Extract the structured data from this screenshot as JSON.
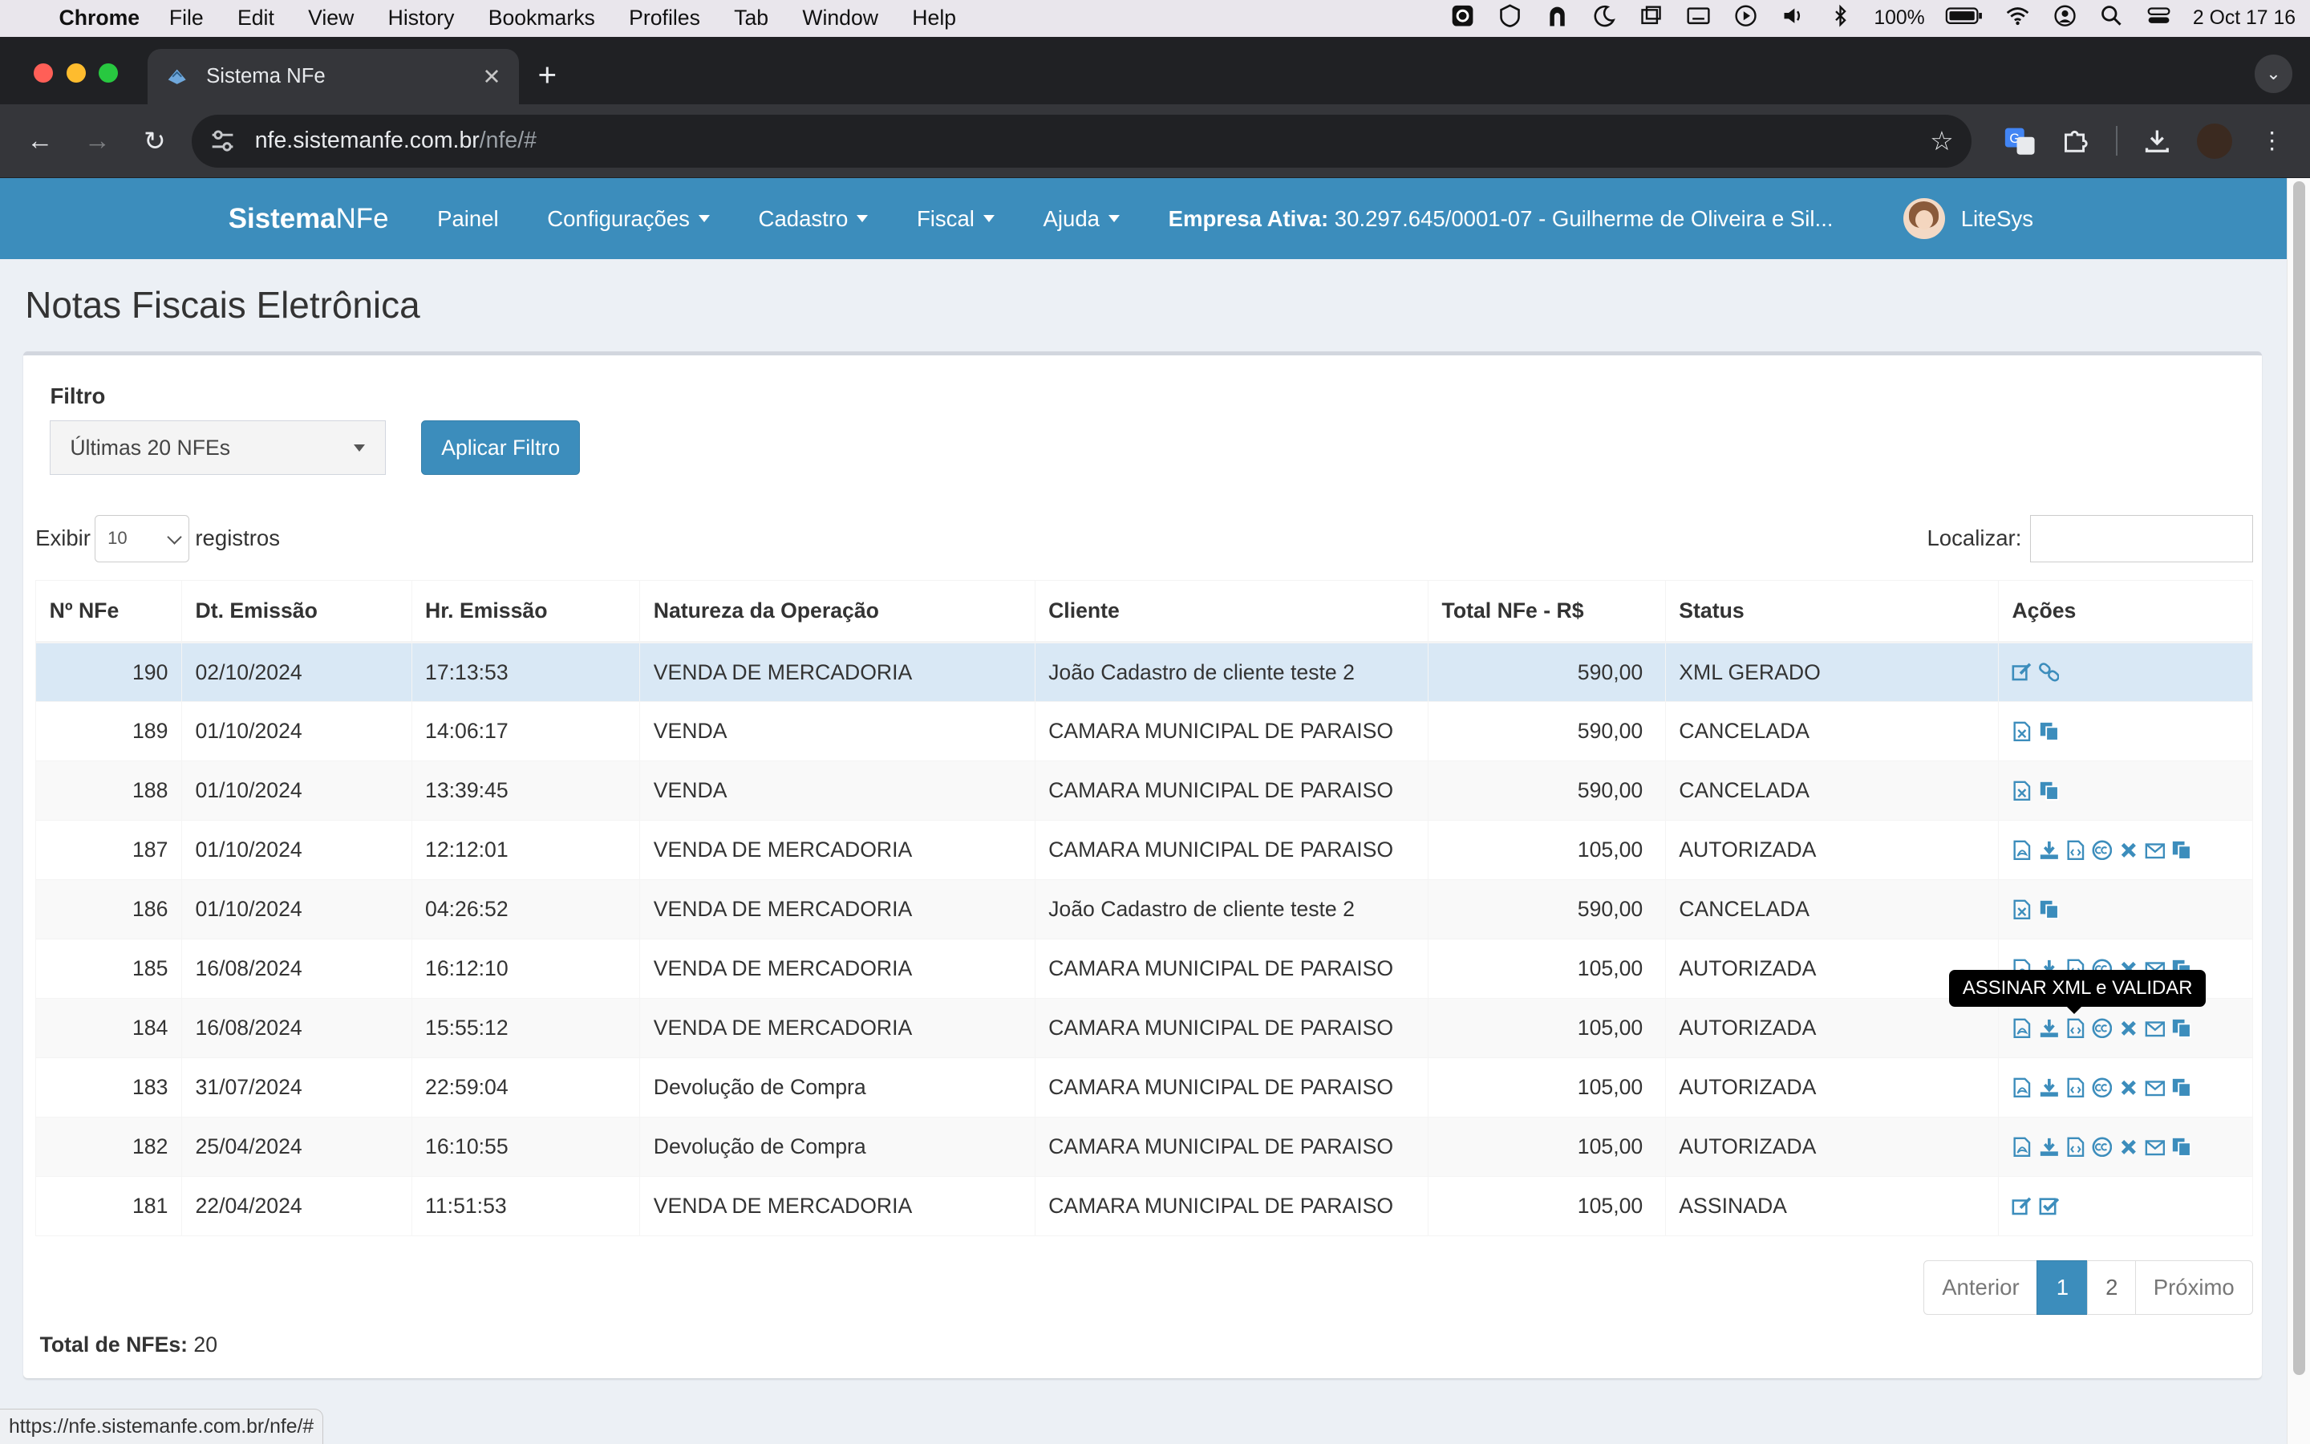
{
  "macos": {
    "app_name": "Chrome",
    "menu": [
      "File",
      "Edit",
      "View",
      "History",
      "Bookmarks",
      "Profiles",
      "Tab",
      "Window",
      "Help"
    ],
    "battery": "100%",
    "clock": "2 Oct  17 16"
  },
  "browser": {
    "tab_title": "Sistema NFe",
    "url_host": "nfe.sistemanfe.com.br",
    "url_path": "/nfe/#",
    "status_url": "https://nfe.sistemanfe.com.br/nfe/#"
  },
  "navbar": {
    "brand_bold": "Sistema",
    "brand_rest": "NFe",
    "items": [
      "Painel",
      "Configurações",
      "Cadastro",
      "Fiscal",
      "Ajuda"
    ],
    "empresa_label": "Empresa Ativa:",
    "empresa_value": " 30.297.645/0001-07 - Guilherme de Oliveira e Sil...",
    "user_name": "LiteSys"
  },
  "page": {
    "title": "Notas Fiscais Eletrônica",
    "filter_label": "Filtro",
    "filter_value": "Últimas 20 NFEs",
    "apply_button": "Aplicar Filtro",
    "show_label": "Exibir",
    "page_length": "10",
    "records_label": "registros",
    "search_label": "Localizar:",
    "tooltip": "ASSINAR XML e VALIDAR",
    "total_label": "Total de NFEs:",
    "total_value": " 20"
  },
  "table": {
    "headers": [
      "Nº NFe",
      "Dt. Emissão",
      "Hr. Emissão",
      "Natureza da Operação",
      "Cliente",
      "Total NFe - R$",
      "Status",
      "Ações"
    ],
    "rows": [
      {
        "n": "190",
        "dt": "02/10/2024",
        "hr": "17:13:53",
        "nat": "VENDA DE MERCADORIA",
        "cli": "João Cadastro de cliente teste 2",
        "tot": "590,00",
        "st": "XML GERADO",
        "acts": [
          "edit-icon",
          "link-icon"
        ]
      },
      {
        "n": "189",
        "dt": "01/10/2024",
        "hr": "14:06:17",
        "nat": "VENDA",
        "cli": "CAMARA MUNICIPAL DE PARAISO",
        "tot": "590,00",
        "st": "CANCELADA",
        "acts": [
          "xml-file-icon",
          "copy-icon"
        ]
      },
      {
        "n": "188",
        "dt": "01/10/2024",
        "hr": "13:39:45",
        "nat": "VENDA",
        "cli": "CAMARA MUNICIPAL DE PARAISO",
        "tot": "590,00",
        "st": "CANCELADA",
        "acts": [
          "xml-file-icon",
          "copy-icon"
        ]
      },
      {
        "n": "187",
        "dt": "01/10/2024",
        "hr": "12:12:01",
        "nat": "VENDA DE MERCADORIA",
        "cli": "CAMARA MUNICIPAL DE PARAISO",
        "tot": "105,00",
        "st": "AUTORIZADA",
        "acts": [
          "pdf-icon",
          "download-icon",
          "code-file-icon",
          "cc-icon",
          "cancel-icon",
          "envelope-icon",
          "copy-icon"
        ]
      },
      {
        "n": "186",
        "dt": "01/10/2024",
        "hr": "04:26:52",
        "nat": "VENDA DE MERCADORIA",
        "cli": "João Cadastro de cliente teste 2",
        "tot": "590,00",
        "st": "CANCELADA",
        "acts": [
          "xml-file-icon",
          "copy-icon"
        ]
      },
      {
        "n": "185",
        "dt": "16/08/2024",
        "hr": "16:12:10",
        "nat": "VENDA DE MERCADORIA",
        "cli": "CAMARA MUNICIPAL DE PARAISO",
        "tot": "105,00",
        "st": "AUTORIZADA",
        "acts": [
          "pdf-icon",
          "download-icon",
          "code-file-icon",
          "cc-icon",
          "cancel-icon",
          "envelope-icon",
          "copy-icon"
        ]
      },
      {
        "n": "184",
        "dt": "16/08/2024",
        "hr": "15:55:12",
        "nat": "VENDA DE MERCADORIA",
        "cli": "CAMARA MUNICIPAL DE PARAISO",
        "tot": "105,00",
        "st": "AUTORIZADA",
        "acts": [
          "pdf-icon",
          "download-icon",
          "code-file-icon",
          "cc-icon",
          "cancel-icon",
          "envelope-icon",
          "copy-icon"
        ]
      },
      {
        "n": "183",
        "dt": "31/07/2024",
        "hr": "22:59:04",
        "nat": "Devolução de Compra",
        "cli": "CAMARA MUNICIPAL DE PARAISO",
        "tot": "105,00",
        "st": "AUTORIZADA",
        "acts": [
          "pdf-icon",
          "download-icon",
          "code-file-icon",
          "cc-icon",
          "cancel-icon",
          "envelope-icon",
          "copy-icon"
        ]
      },
      {
        "n": "182",
        "dt": "25/04/2024",
        "hr": "16:10:55",
        "nat": "Devolução de Compra",
        "cli": "CAMARA MUNICIPAL DE PARAISO",
        "tot": "105,00",
        "st": "AUTORIZADA",
        "acts": [
          "pdf-icon",
          "download-icon",
          "code-file-icon",
          "cc-icon",
          "cancel-icon",
          "envelope-icon",
          "copy-icon"
        ]
      },
      {
        "n": "181",
        "dt": "22/04/2024",
        "hr": "11:51:53",
        "nat": "VENDA DE MERCADORIA",
        "cli": "CAMARA MUNICIPAL DE PARAISO",
        "tot": "105,00",
        "st": "ASSINADA",
        "acts": [
          "edit-icon",
          "check-square-icon"
        ]
      }
    ]
  },
  "pagination": {
    "prev": "Anterior",
    "pages": [
      "1",
      "2"
    ],
    "next": "Próximo"
  },
  "colors": {
    "primary": "#3c8dbc",
    "selected_row": "#d9e8f5"
  }
}
